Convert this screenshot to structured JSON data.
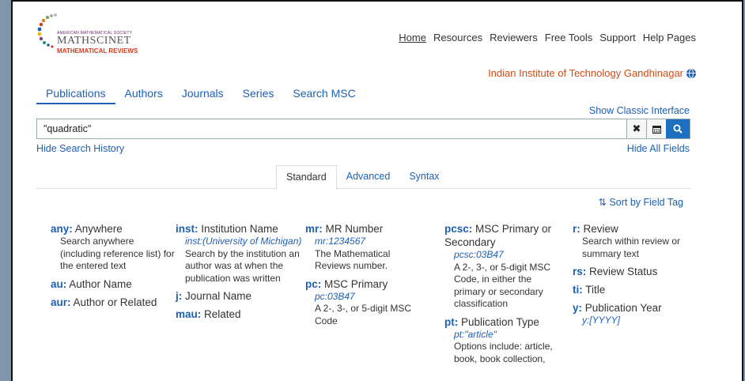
{
  "logo": {
    "line1": "AMERICAN MATHEMATICAL SOCIETY",
    "line2": "MATHSCINET",
    "line3": "MATHEMATICAL REVIEWS"
  },
  "topnav": [
    "Home",
    "Resources",
    "Reviewers",
    "Free Tools",
    "Support",
    "Help Pages"
  ],
  "institution": "Indian Institute of Technology Gandhinagar",
  "tabs": [
    "Publications",
    "Authors",
    "Journals",
    "Series",
    "Search MSC"
  ],
  "classic_link": "Show Classic Interface",
  "search": {
    "value": "\"quadratic\""
  },
  "hide_history": "Hide Search History",
  "hide_fields": "Hide All Fields",
  "subtabs": [
    "Standard",
    "Advanced",
    "Syntax"
  ],
  "sort_label": "Sort by Field Tag",
  "fields": {
    "any_tag": "any:",
    "any_name": "Anywhere",
    "any_desc": "Search anywhere (including reference list) for the entered text",
    "au_tag": "au:",
    "au_name": "Author Name",
    "aur_tag": "aur:",
    "aur_name": "Author or Related",
    "inst_tag": "inst:",
    "inst_name": "Institution Name",
    "inst_ex": "inst:(University of Michigan)",
    "inst_desc": "Search by the institution an author was at when the publication was written",
    "j_tag": "j:",
    "j_name": "Journal Name",
    "mau_tag": "mau:",
    "mau_name": "Related",
    "mr_tag": "mr:",
    "mr_name": "MR Number",
    "mr_ex": "mr:1234567",
    "mr_desc": "The Mathematical Reviews number.",
    "pc_tag": "pc:",
    "pc_name": "MSC Primary",
    "pc_ex": "pc:03B47",
    "pc_desc": "A 2-, 3-, or 5-digit MSC Code",
    "pcsc_tag": "pcsc:",
    "pcsc_name": "MSC Primary or Secondary",
    "pcsc_ex": "pcsc:03B47",
    "pcsc_desc": "A 2-, 3-, or 5-digit MSC Code, in either the primary or secondary classification",
    "pt_tag": "pt:",
    "pt_name": "Publication Type",
    "pt_ex": "pt:\"article\"",
    "pt_desc": "Options include: article, book, book collection,",
    "r_tag": "r:",
    "r_name": "Review",
    "r_desc": "Search within review or summary text",
    "rs_tag": "rs:",
    "rs_name": "Review Status",
    "ti_tag": "ti:",
    "ti_name": "Title",
    "y_tag": "y:",
    "y_name": "Publication Year",
    "y_ex": "y:[YYYY]"
  }
}
